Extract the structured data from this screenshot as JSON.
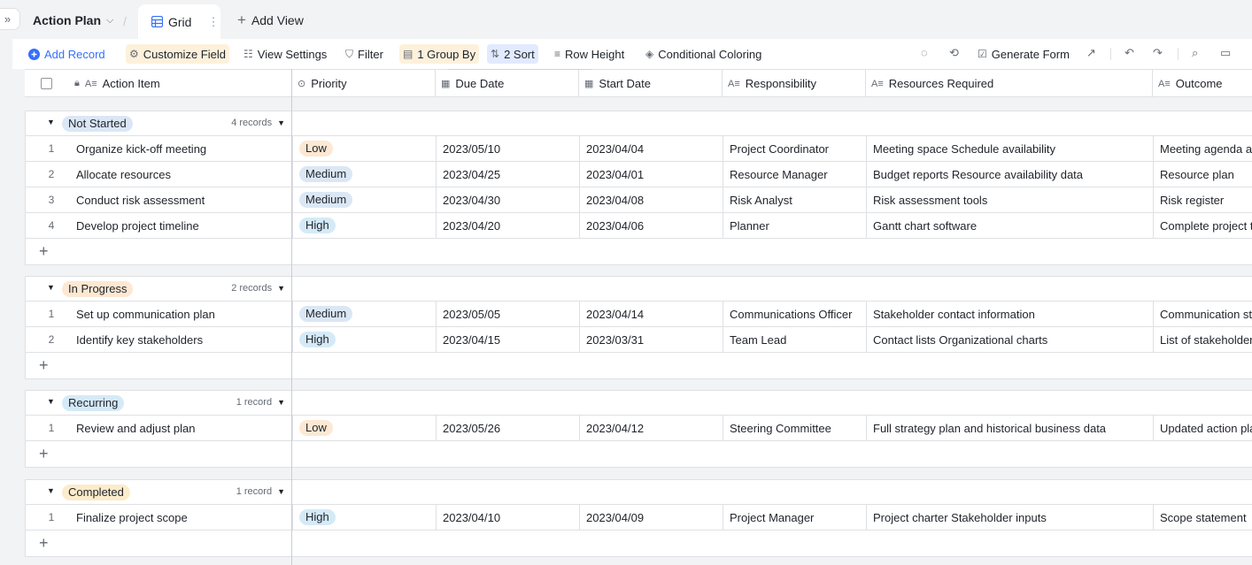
{
  "app": {
    "title": "Action Plan",
    "view_tab": "Grid",
    "add_view": "Add View"
  },
  "toolbar": {
    "add_record": "Add Record",
    "customize_field": "Customize Field",
    "view_settings": "View Settings",
    "filter": "Filter",
    "group_by": "1 Group By",
    "sort": "2 Sort",
    "row_height": "Row Height",
    "conditional_coloring": "Conditional Coloring",
    "generate_form": "Generate Form"
  },
  "columns": {
    "action_item": "Action Item",
    "priority": "Priority",
    "due_date": "Due Date",
    "start_date": "Start Date",
    "responsibility": "Responsibility",
    "resources_required": "Resources Required",
    "outcome": "Outcome"
  },
  "priority_colors": {
    "Low": "#fde8d3",
    "Medium": "#dbe7f5",
    "High": "#d5eaf7"
  },
  "groups": [
    {
      "name": "Not Started",
      "color": "#dbe7f5",
      "count": "4 records",
      "rows": [
        {
          "num": "1",
          "item": "Organize kick-off meeting",
          "priority": "Low",
          "due": "2023/05/10",
          "start": "2023/04/04",
          "resp": "Project Coordinator",
          "res": "Meeting space Schedule availability",
          "outcome": "Meeting agenda and minutes"
        },
        {
          "num": "2",
          "item": "Allocate resources",
          "priority": "Medium",
          "due": "2023/04/25",
          "start": "2023/04/01",
          "resp": "Resource Manager",
          "res": "Budget reports Resource availability data",
          "outcome": "Resource plan"
        },
        {
          "num": "3",
          "item": "Conduct risk assessment",
          "priority": "Medium",
          "due": "2023/04/30",
          "start": "2023/04/08",
          "resp": "Risk Analyst",
          "res": "Risk assessment tools",
          "outcome": "Risk register"
        },
        {
          "num": "4",
          "item": "Develop project timeline",
          "priority": "High",
          "due": "2023/04/20",
          "start": "2023/04/06",
          "resp": "Planner",
          "res": "Gantt chart software",
          "outcome": "Complete project timeline"
        }
      ]
    },
    {
      "name": "In Progress",
      "color": "#fde8d3",
      "count": "2 records",
      "rows": [
        {
          "num": "1",
          "item": "Set up communication plan",
          "priority": "Medium",
          "due": "2023/05/05",
          "start": "2023/04/14",
          "resp": "Communications Officer",
          "res": "Stakeholder contact information",
          "outcome": "Communication strategy"
        },
        {
          "num": "2",
          "item": "Identify key stakeholders",
          "priority": "High",
          "due": "2023/04/15",
          "start": "2023/03/31",
          "resp": "Team Lead",
          "res": "Contact lists Organizational charts",
          "outcome": "List of stakeholders"
        }
      ]
    },
    {
      "name": "Recurring",
      "color": "#d5eaf7",
      "count": "1 record",
      "rows": [
        {
          "num": "1",
          "item": "Review and adjust plan",
          "priority": "Low",
          "due": "2023/05/26",
          "start": "2023/04/12",
          "resp": "Steering Committee",
          "res": "Full strategy plan and historical business data",
          "outcome": "Updated action plan"
        }
      ]
    },
    {
      "name": "Completed",
      "color": "#fbeccb",
      "count": "1 record",
      "rows": [
        {
          "num": "1",
          "item": "Finalize project scope",
          "priority": "High",
          "due": "2023/04/10",
          "start": "2023/04/09",
          "resp": "Project Manager",
          "res": "Project charter Stakeholder inputs",
          "outcome": "Scope statement"
        }
      ]
    }
  ]
}
